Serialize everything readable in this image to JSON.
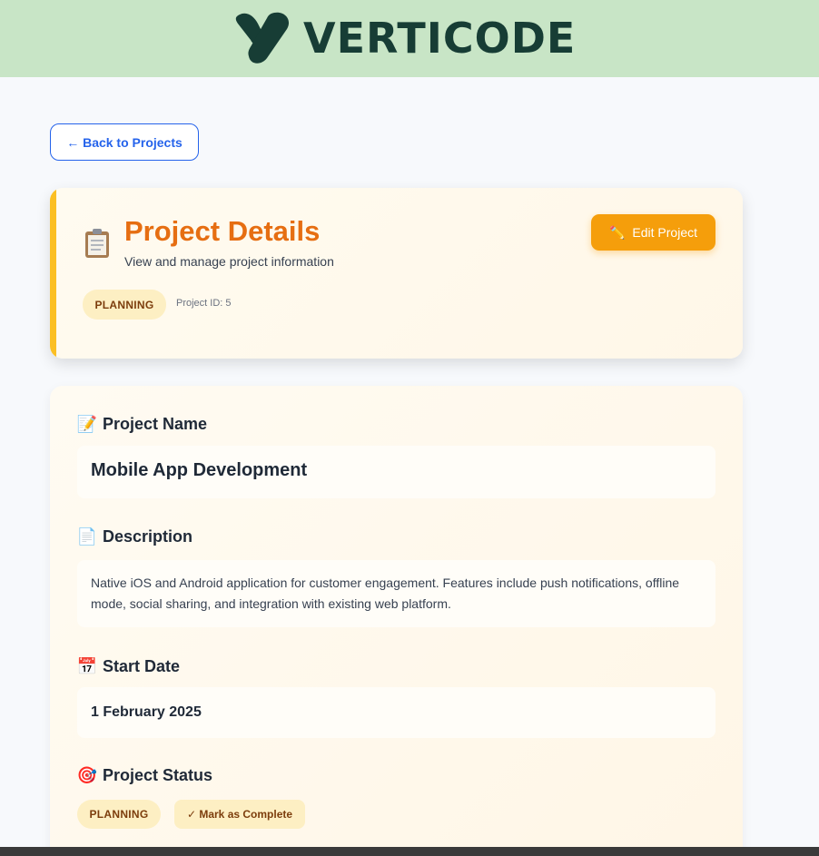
{
  "brand": {
    "name": "VERTICODE",
    "colors": {
      "header_bg": "#c8e5c6",
      "logo": "#173d35"
    }
  },
  "nav": {
    "back_label": "← Back to Projects"
  },
  "header_card": {
    "icon": "clipboard-icon",
    "title": "Project Details",
    "subtitle": "View and manage project information",
    "edit_label": "Edit Project",
    "edit_icon": "pencil-icon",
    "status": "PLANNING",
    "project_id": "Project ID: 5"
  },
  "details": {
    "name_label": "Project Name",
    "name_icon": "memo-icon",
    "name_value": "Mobile App Development",
    "description_label": "Description",
    "description_icon": "document-icon",
    "description_value": "Native iOS and Android application for customer engagement. Features include push notifications, offline mode, social sharing, and integration with existing web platform.",
    "start_date_label": "Start Date",
    "start_date_icon": "calendar-icon",
    "start_date_value": "1 February 2025",
    "status_label": "Project Status",
    "status_icon": "target-icon",
    "status_value": "PLANNING",
    "complete_label": "✓ Mark as Complete"
  },
  "theme": {
    "accent": "#f59e0b",
    "title_color": "#e66e12",
    "link_color": "#2563eb",
    "badge_bg": "#fdefc3",
    "badge_text": "#7c3d0c"
  }
}
